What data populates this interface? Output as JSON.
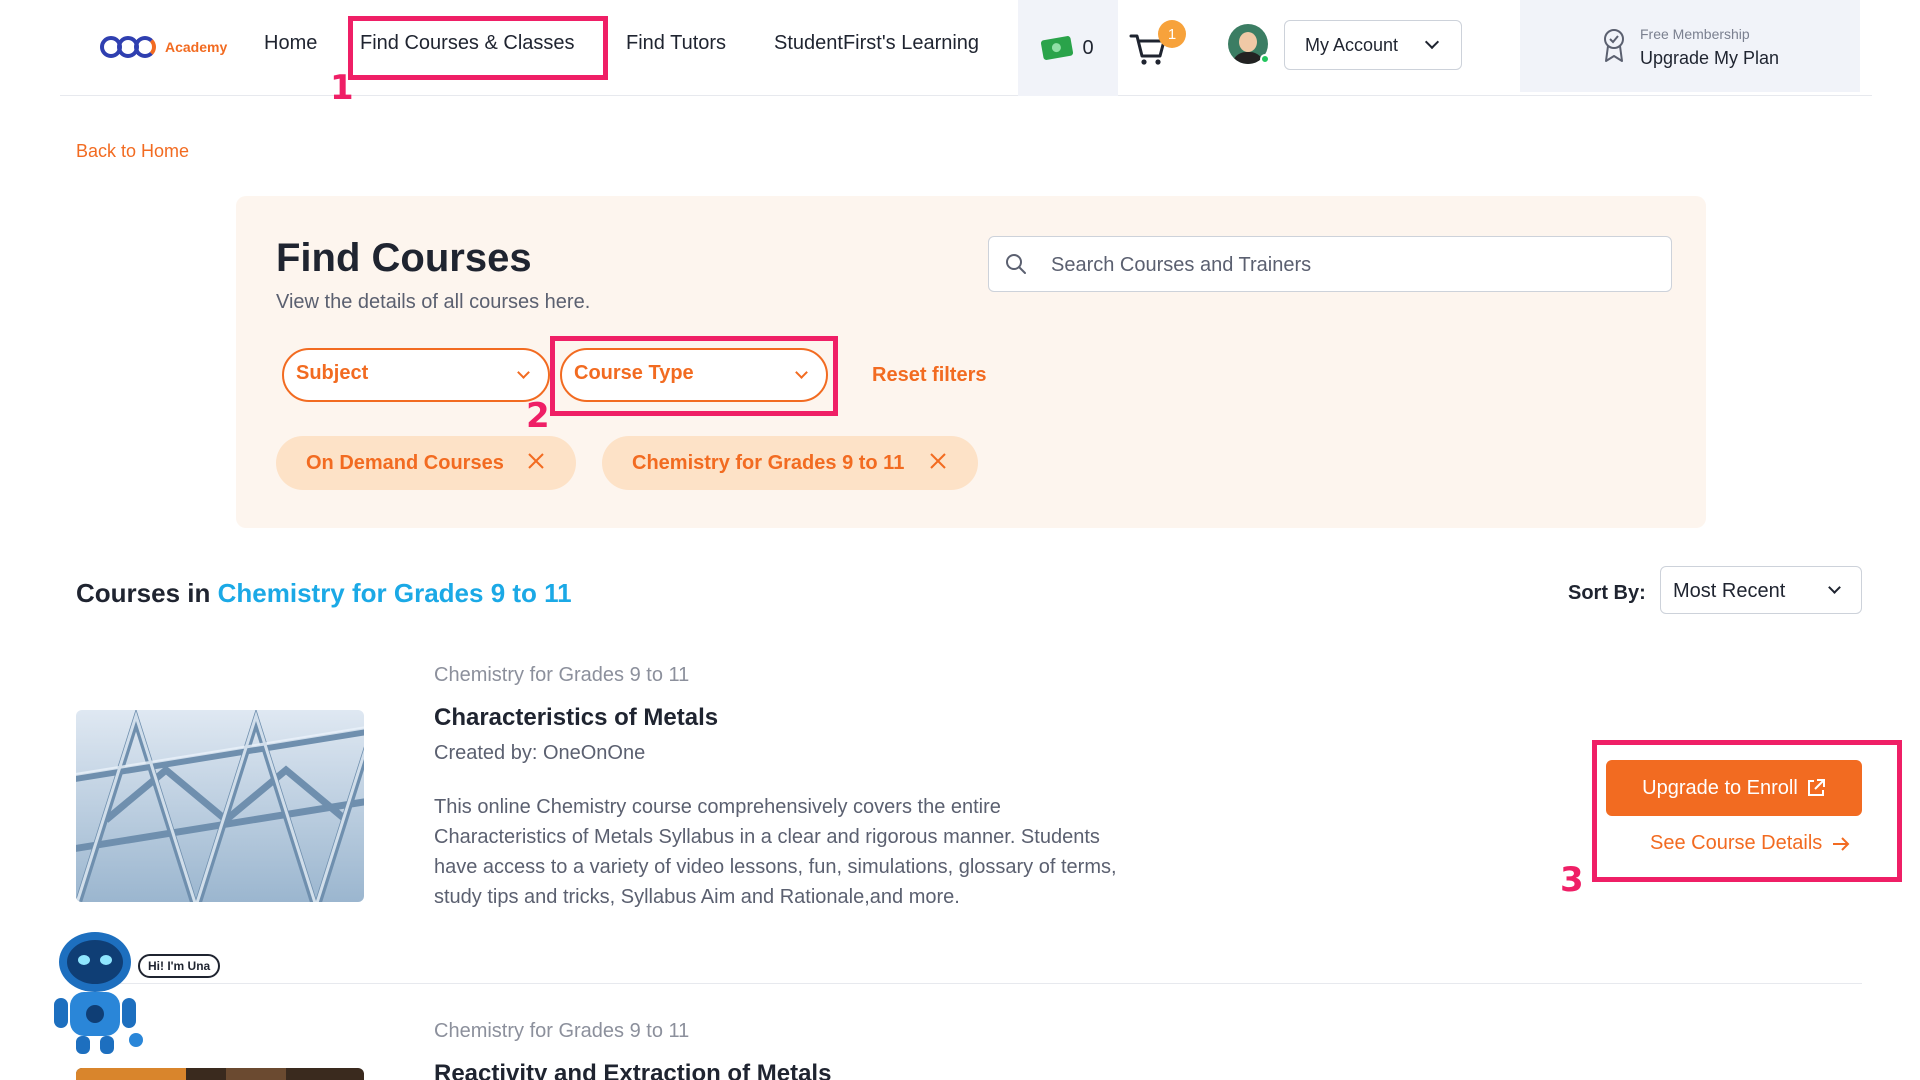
{
  "header": {
    "logo_text": "Academy",
    "nav": {
      "home": "Home",
      "find_courses": "Find Courses & Classes",
      "find_tutors": "Find Tutors",
      "learning": "StudentFirst's Learning"
    },
    "wallet_count": "0",
    "cart_badge": "1",
    "account_label": "My Account",
    "membership": {
      "subtitle": "Free Membership",
      "title": "Upgrade My Plan"
    }
  },
  "annotations": {
    "step_1": "1",
    "step_2": "2",
    "step_3": "3"
  },
  "back_link": "Back to Home",
  "filters": {
    "title": "Find Courses",
    "subtitle": "View the details of all courses here.",
    "search_placeholder": "Search Courses and Trainers",
    "subject_label": "Subject",
    "course_type_label": "Course Type",
    "reset_label": "Reset filters",
    "chips": [
      "On Demand Courses",
      "Chemistry for Grades 9 to 11"
    ]
  },
  "results": {
    "prefix": "Courses in",
    "category": "Chemistry for Grades 9 to 11",
    "sort_label": "Sort By:",
    "sort_value": "Most Recent",
    "courses": [
      {
        "category": "Chemistry for Grades 9 to 11",
        "name": "Characteristics of Metals",
        "author": "Created by: OneOnOne",
        "description": "This online Chemistry course comprehensively covers the entire Characteristics of Metals Syllabus in a clear and rigorous manner. Students have access to a variety of video lessons, fun, simulations, glossary of terms, study tips and tricks, Syllabus Aim and Rationale,and more.",
        "enroll_label": "Upgrade to Enroll",
        "details_label": "See Course Details"
      },
      {
        "category": "Chemistry for Grades 9 to 11",
        "name": "Reactivity and Extraction of Metals"
      }
    ]
  },
  "chatbot": {
    "greeting": "Hi! I'm Una"
  },
  "colors": {
    "accent": "#f26b21",
    "highlight": "#ef1f66",
    "link_blue": "#1ba9e6"
  }
}
